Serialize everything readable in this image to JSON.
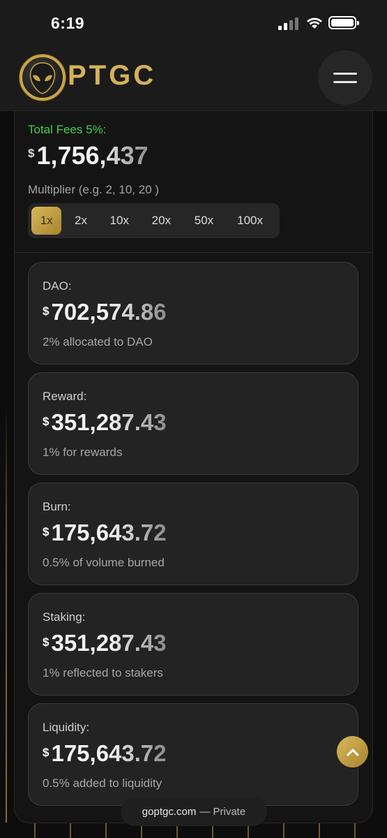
{
  "status_bar": {
    "time": "6:19"
  },
  "header": {
    "logo_text": "PTGC"
  },
  "calculator": {
    "total_fees_label": "Total Fees 5%:",
    "total_fees_currency": "$",
    "total_fees_value": "1,756,437",
    "multiplier_label": "Multiplier (e.g. 2, 10, 20 )",
    "multipliers": [
      "1x",
      "2x",
      "10x",
      "20x",
      "50x",
      "100x"
    ],
    "selected_multiplier": "1x"
  },
  "cards": [
    {
      "label": "DAO:",
      "currency": "$",
      "value": "702,574.86",
      "desc": "2% allocated to DAO"
    },
    {
      "label": "Reward:",
      "currency": "$",
      "value": "351,287.43",
      "desc": "1% for rewards"
    },
    {
      "label": "Burn:",
      "currency": "$",
      "value": "175,643.72",
      "desc": "0.5% of volume burned"
    },
    {
      "label": "Staking:",
      "currency": "$",
      "value": "351,287.43",
      "desc": "1% reflected to stakers"
    },
    {
      "label": "Liquidity:",
      "currency": "$",
      "value": "175,643.72",
      "desc": "0.5% added to liquidity"
    }
  ],
  "browser": {
    "url": "goptgc.com",
    "mode": "— Private"
  },
  "colors": {
    "accent_gold": "#c9a545",
    "fees_green": "#3fcf4c",
    "card_bg": "#232323"
  }
}
